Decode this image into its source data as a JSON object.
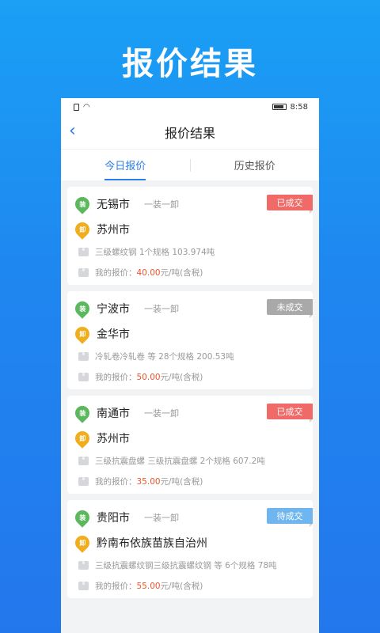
{
  "hero_title": "报价结果",
  "status_bar": {
    "time": "8:58"
  },
  "nav": {
    "back_icon": "chevron-left-icon",
    "title": "报价结果"
  },
  "tabs": [
    {
      "label": "今日报价",
      "active": true
    },
    {
      "label": "历史报价",
      "active": false
    }
  ],
  "cards": [
    {
      "origin": "无锡市",
      "mode": "一装一卸",
      "destination": "苏州市",
      "goods": "三级螺纹钢  1个规格  103.974吨",
      "price_label": "我的报价：",
      "price": "40.00",
      "price_unit": "元/吨(含税)",
      "status": "已成交",
      "status_color": "#f06a68"
    },
    {
      "origin": "宁波市",
      "mode": "一装一卸",
      "destination": "金华市",
      "goods": "冷轧卷冷轧卷  等  28个规格  200.53吨",
      "price_label": "我的报价：",
      "price": "50.00",
      "price_unit": "元/吨(含税)",
      "status": "未成交",
      "status_color": "#a9a9a9"
    },
    {
      "origin": "南通市",
      "mode": "一装一卸",
      "destination": "苏州市",
      "goods": "三级抗震盘螺  三级抗震盘螺  2个规格  607.2吨",
      "price_label": "我的报价：",
      "price": "35.00",
      "price_unit": "元/吨(含税)",
      "status": "已成交",
      "status_color": "#f06a68"
    },
    {
      "origin": "贵阳市",
      "mode": "一装一卸",
      "destination": "黔南布依族苗族自治州",
      "goods": "三级抗震螺纹钢三级抗震螺纹钢  等  6个规格  78吨",
      "price_label": "我的报价：",
      "price": "55.00",
      "price_unit": "元/吨(含税)",
      "status": "待成交",
      "status_color": "#6fb6f0"
    }
  ],
  "pins": {
    "load": "装",
    "unload": "卸"
  }
}
